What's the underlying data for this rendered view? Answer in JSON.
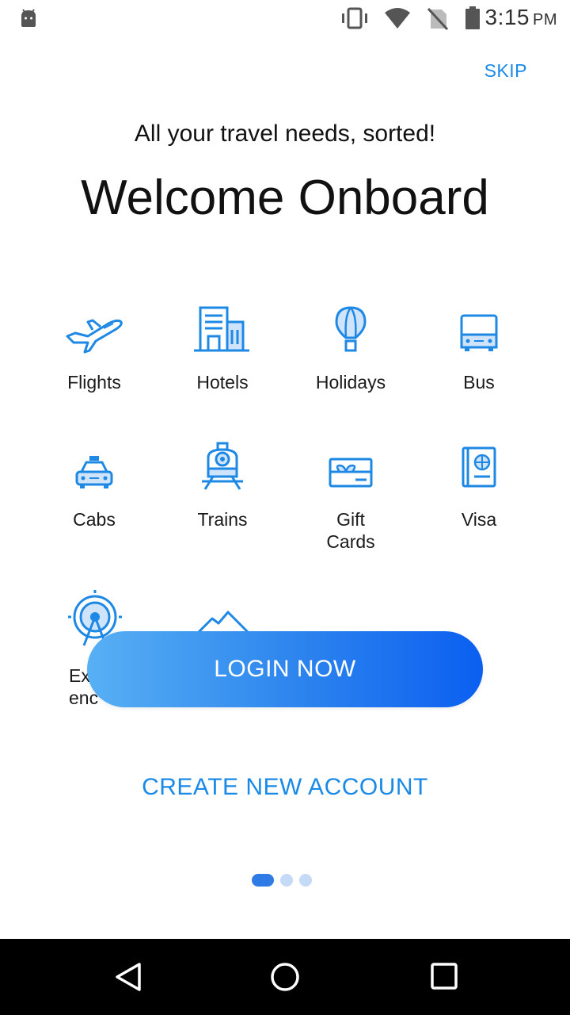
{
  "status_bar": {
    "time": "3:15",
    "ampm": "PM",
    "icons": [
      "android-icon",
      "vibrate-icon",
      "wifi-icon",
      "no-sim-icon",
      "battery-icon"
    ]
  },
  "header": {
    "skip_label": "SKIP",
    "subtitle": "All your travel needs, sorted!",
    "title": "Welcome Onboard"
  },
  "services": {
    "flights": "Flights",
    "hotels": "Hotels",
    "holidays": "Holidays",
    "bus": "Bus",
    "cabs": "Cabs",
    "trains": "Trains",
    "gift_cards_line1": "Gift",
    "gift_cards_line2": "Cards",
    "visa": "Visa",
    "experiences_line1": "Ex",
    "experiences_line2": "enc"
  },
  "actions": {
    "login_label": "LOGIN NOW",
    "create_account_label": "CREATE NEW ACCOUNT"
  },
  "pager": {
    "pages": 3,
    "active": 1
  },
  "colors": {
    "accent": "#1a8ae6",
    "icon": "#1e88e5",
    "gradient_start": "#58b0f4",
    "gradient_end": "#0b5ff0"
  },
  "nav_bar": {
    "icons": [
      "back-icon",
      "home-icon",
      "recents-icon"
    ]
  }
}
